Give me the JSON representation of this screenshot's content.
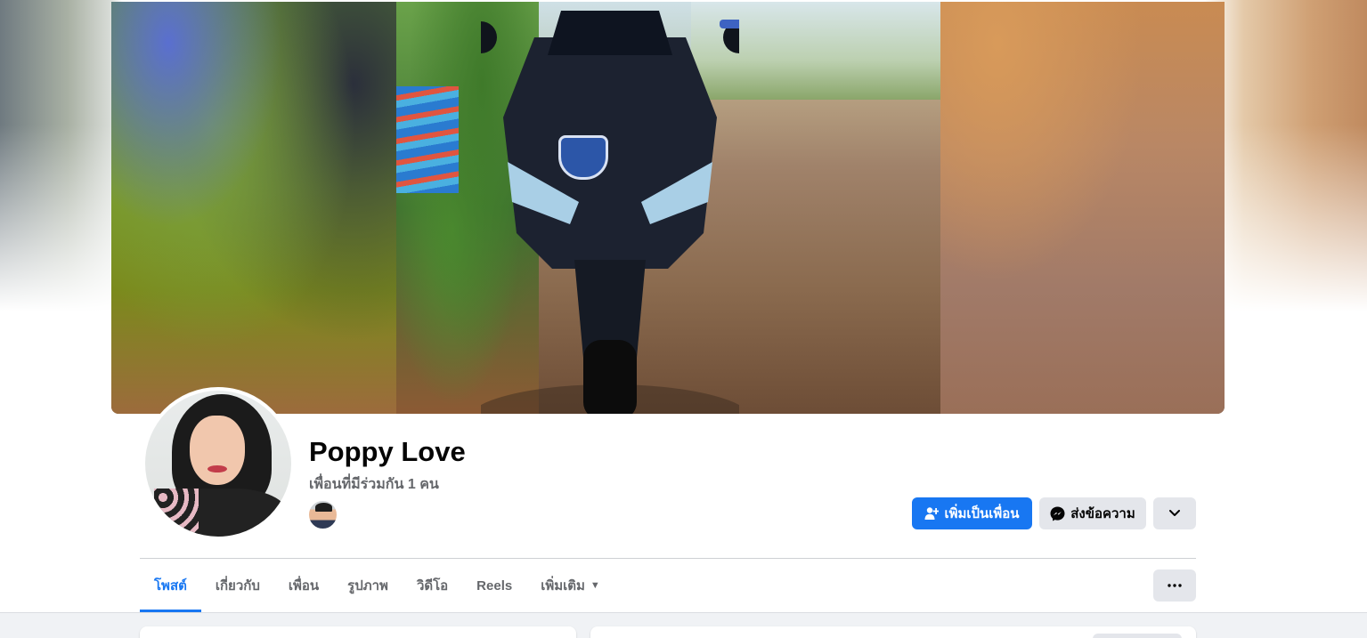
{
  "profile": {
    "name": "Poppy Love",
    "mutual_friends": "เพื่อนที่มีร่วมกัน 1 คน"
  },
  "actions": {
    "add_friend_label": "เพิ่มเป็นเพื่อน",
    "add_friend_icon": "add-friend-icon",
    "message_label": "ส่งข้อความ",
    "message_icon": "messenger-icon",
    "chevron_icon": "chevron-down-icon",
    "more_icon": "ellipsis-icon"
  },
  "tabs": [
    {
      "label": "โพสต์",
      "active": true
    },
    {
      "label": "เกี่ยวกับ",
      "active": false
    },
    {
      "label": "เพื่อน",
      "active": false
    },
    {
      "label": "รูปภาพ",
      "active": false
    },
    {
      "label": "วิดีโอ",
      "active": false
    },
    {
      "label": "Reels",
      "active": false
    },
    {
      "label": "เพิ่มเติม",
      "active": false
    }
  ],
  "colors": {
    "accent": "#1877f2",
    "secondary_button": "#e4e6eb",
    "text_primary": "#050505",
    "text_secondary": "#65676b",
    "feed_background": "#f0f2f5"
  }
}
